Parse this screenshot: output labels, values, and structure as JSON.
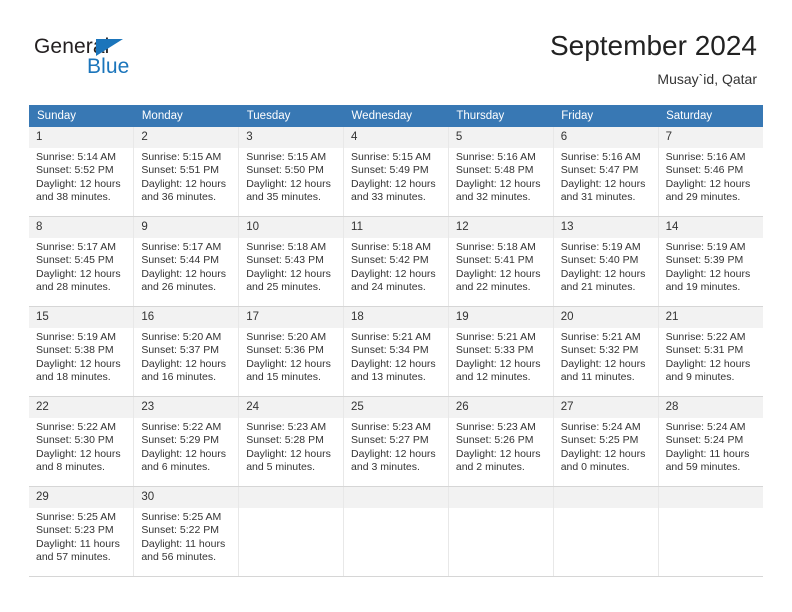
{
  "brand": {
    "name_top": "General",
    "name_bottom": "Blue"
  },
  "header": {
    "title": "September 2024",
    "subtitle": "Musay`id, Qatar"
  },
  "colors": {
    "header_blue": "#3878b4",
    "brand_blue": "#1b75bb",
    "daynum_band": "#f2f2f2",
    "cell_border": "#d6d6d6"
  },
  "weekdays": [
    "Sunday",
    "Monday",
    "Tuesday",
    "Wednesday",
    "Thursday",
    "Friday",
    "Saturday"
  ],
  "labels": {
    "sunrise_prefix": "Sunrise:",
    "sunset_prefix": "Sunset:",
    "daylight_prefix": "Daylight:"
  },
  "weeks": [
    [
      {
        "day": "1",
        "sunrise": "Sunrise: 5:14 AM",
        "sunset": "Sunset: 5:52 PM",
        "daylight_1": "Daylight: 12 hours",
        "daylight_2": "and 38 minutes."
      },
      {
        "day": "2",
        "sunrise": "Sunrise: 5:15 AM",
        "sunset": "Sunset: 5:51 PM",
        "daylight_1": "Daylight: 12 hours",
        "daylight_2": "and 36 minutes."
      },
      {
        "day": "3",
        "sunrise": "Sunrise: 5:15 AM",
        "sunset": "Sunset: 5:50 PM",
        "daylight_1": "Daylight: 12 hours",
        "daylight_2": "and 35 minutes."
      },
      {
        "day": "4",
        "sunrise": "Sunrise: 5:15 AM",
        "sunset": "Sunset: 5:49 PM",
        "daylight_1": "Daylight: 12 hours",
        "daylight_2": "and 33 minutes."
      },
      {
        "day": "5",
        "sunrise": "Sunrise: 5:16 AM",
        "sunset": "Sunset: 5:48 PM",
        "daylight_1": "Daylight: 12 hours",
        "daylight_2": "and 32 minutes."
      },
      {
        "day": "6",
        "sunrise": "Sunrise: 5:16 AM",
        "sunset": "Sunset: 5:47 PM",
        "daylight_1": "Daylight: 12 hours",
        "daylight_2": "and 31 minutes."
      },
      {
        "day": "7",
        "sunrise": "Sunrise: 5:16 AM",
        "sunset": "Sunset: 5:46 PM",
        "daylight_1": "Daylight: 12 hours",
        "daylight_2": "and 29 minutes."
      }
    ],
    [
      {
        "day": "8",
        "sunrise": "Sunrise: 5:17 AM",
        "sunset": "Sunset: 5:45 PM",
        "daylight_1": "Daylight: 12 hours",
        "daylight_2": "and 28 minutes."
      },
      {
        "day": "9",
        "sunrise": "Sunrise: 5:17 AM",
        "sunset": "Sunset: 5:44 PM",
        "daylight_1": "Daylight: 12 hours",
        "daylight_2": "and 26 minutes."
      },
      {
        "day": "10",
        "sunrise": "Sunrise: 5:18 AM",
        "sunset": "Sunset: 5:43 PM",
        "daylight_1": "Daylight: 12 hours",
        "daylight_2": "and 25 minutes."
      },
      {
        "day": "11",
        "sunrise": "Sunrise: 5:18 AM",
        "sunset": "Sunset: 5:42 PM",
        "daylight_1": "Daylight: 12 hours",
        "daylight_2": "and 24 minutes."
      },
      {
        "day": "12",
        "sunrise": "Sunrise: 5:18 AM",
        "sunset": "Sunset: 5:41 PM",
        "daylight_1": "Daylight: 12 hours",
        "daylight_2": "and 22 minutes."
      },
      {
        "day": "13",
        "sunrise": "Sunrise: 5:19 AM",
        "sunset": "Sunset: 5:40 PM",
        "daylight_1": "Daylight: 12 hours",
        "daylight_2": "and 21 minutes."
      },
      {
        "day": "14",
        "sunrise": "Sunrise: 5:19 AM",
        "sunset": "Sunset: 5:39 PM",
        "daylight_1": "Daylight: 12 hours",
        "daylight_2": "and 19 minutes."
      }
    ],
    [
      {
        "day": "15",
        "sunrise": "Sunrise: 5:19 AM",
        "sunset": "Sunset: 5:38 PM",
        "daylight_1": "Daylight: 12 hours",
        "daylight_2": "and 18 minutes."
      },
      {
        "day": "16",
        "sunrise": "Sunrise: 5:20 AM",
        "sunset": "Sunset: 5:37 PM",
        "daylight_1": "Daylight: 12 hours",
        "daylight_2": "and 16 minutes."
      },
      {
        "day": "17",
        "sunrise": "Sunrise: 5:20 AM",
        "sunset": "Sunset: 5:36 PM",
        "daylight_1": "Daylight: 12 hours",
        "daylight_2": "and 15 minutes."
      },
      {
        "day": "18",
        "sunrise": "Sunrise: 5:21 AM",
        "sunset": "Sunset: 5:34 PM",
        "daylight_1": "Daylight: 12 hours",
        "daylight_2": "and 13 minutes."
      },
      {
        "day": "19",
        "sunrise": "Sunrise: 5:21 AM",
        "sunset": "Sunset: 5:33 PM",
        "daylight_1": "Daylight: 12 hours",
        "daylight_2": "and 12 minutes."
      },
      {
        "day": "20",
        "sunrise": "Sunrise: 5:21 AM",
        "sunset": "Sunset: 5:32 PM",
        "daylight_1": "Daylight: 12 hours",
        "daylight_2": "and 11 minutes."
      },
      {
        "day": "21",
        "sunrise": "Sunrise: 5:22 AM",
        "sunset": "Sunset: 5:31 PM",
        "daylight_1": "Daylight: 12 hours",
        "daylight_2": "and 9 minutes."
      }
    ],
    [
      {
        "day": "22",
        "sunrise": "Sunrise: 5:22 AM",
        "sunset": "Sunset: 5:30 PM",
        "daylight_1": "Daylight: 12 hours",
        "daylight_2": "and 8 minutes."
      },
      {
        "day": "23",
        "sunrise": "Sunrise: 5:22 AM",
        "sunset": "Sunset: 5:29 PM",
        "daylight_1": "Daylight: 12 hours",
        "daylight_2": "and 6 minutes."
      },
      {
        "day": "24",
        "sunrise": "Sunrise: 5:23 AM",
        "sunset": "Sunset: 5:28 PM",
        "daylight_1": "Daylight: 12 hours",
        "daylight_2": "and 5 minutes."
      },
      {
        "day": "25",
        "sunrise": "Sunrise: 5:23 AM",
        "sunset": "Sunset: 5:27 PM",
        "daylight_1": "Daylight: 12 hours",
        "daylight_2": "and 3 minutes."
      },
      {
        "day": "26",
        "sunrise": "Sunrise: 5:23 AM",
        "sunset": "Sunset: 5:26 PM",
        "daylight_1": "Daylight: 12 hours",
        "daylight_2": "and 2 minutes."
      },
      {
        "day": "27",
        "sunrise": "Sunrise: 5:24 AM",
        "sunset": "Sunset: 5:25 PM",
        "daylight_1": "Daylight: 12 hours",
        "daylight_2": "and 0 minutes."
      },
      {
        "day": "28",
        "sunrise": "Sunrise: 5:24 AM",
        "sunset": "Sunset: 5:24 PM",
        "daylight_1": "Daylight: 11 hours",
        "daylight_2": "and 59 minutes."
      }
    ],
    [
      {
        "day": "29",
        "sunrise": "Sunrise: 5:25 AM",
        "sunset": "Sunset: 5:23 PM",
        "daylight_1": "Daylight: 11 hours",
        "daylight_2": "and 57 minutes."
      },
      {
        "day": "30",
        "sunrise": "Sunrise: 5:25 AM",
        "sunset": "Sunset: 5:22 PM",
        "daylight_1": "Daylight: 11 hours",
        "daylight_2": "and 56 minutes."
      },
      {
        "day": "",
        "sunrise": "",
        "sunset": "",
        "daylight_1": "",
        "daylight_2": ""
      },
      {
        "day": "",
        "sunrise": "",
        "sunset": "",
        "daylight_1": "",
        "daylight_2": ""
      },
      {
        "day": "",
        "sunrise": "",
        "sunset": "",
        "daylight_1": "",
        "daylight_2": ""
      },
      {
        "day": "",
        "sunrise": "",
        "sunset": "",
        "daylight_1": "",
        "daylight_2": ""
      },
      {
        "day": "",
        "sunrise": "",
        "sunset": "",
        "daylight_1": "",
        "daylight_2": ""
      }
    ]
  ]
}
